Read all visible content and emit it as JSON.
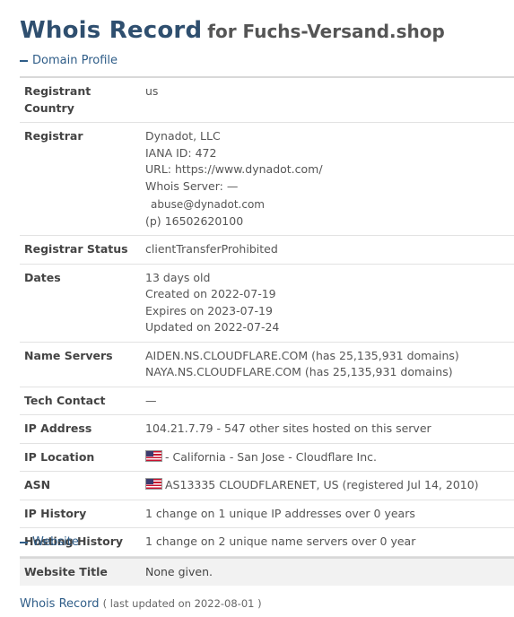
{
  "title": {
    "main": "Whois Record",
    "sub": "for Fuchs-Versand.shop"
  },
  "sections": {
    "domain_profile": "Domain Profile",
    "website": "Website"
  },
  "rows": {
    "registrant_country": {
      "label": "Registrant Country",
      "value": "us"
    },
    "registrar": {
      "label": "Registrar",
      "name": "Dynadot, LLC",
      "iana": "IANA ID: 472",
      "url": "URL: https://www.dynadot.com/",
      "whois_server": "Whois Server: —",
      "email": "abuse@dynadot.com",
      "phone_prefix": "(p)",
      "phone": "16502620100"
    },
    "registrar_status": {
      "label": "Registrar Status",
      "value": "clientTransferProhibited"
    },
    "dates": {
      "label": "Dates",
      "age": "13 days old",
      "created": "Created on 2022-07-19",
      "expires": "Expires on 2023-07-19",
      "updated": "Updated on 2022-07-24"
    },
    "name_servers": {
      "label": "Name Servers",
      "ns1": "AIDEN.NS.CLOUDFLARE.COM (has 25,135,931 domains)",
      "ns2": "NAYA.NS.CLOUDFLARE.COM (has 25,135,931 domains)"
    },
    "tech_contact": {
      "label": "Tech Contact",
      "value": "—"
    },
    "ip_address": {
      "label": "IP Address",
      "value": "104.21.7.79 - 547 other sites hosted on this server"
    },
    "ip_location": {
      "label": "IP Location",
      "value": "- California - San Jose - Cloudflare Inc.",
      "flag": "us-flag-icon"
    },
    "asn": {
      "label": "ASN",
      "value": "AS13335 CLOUDFLARENET, US (registered Jul 14, 2010)",
      "flag": "us-flag-icon"
    },
    "ip_history": {
      "label": "IP History",
      "value": "1 change on 1 unique IP addresses over 0 years"
    },
    "hosting_history": {
      "label": "Hosting History",
      "value": "1 change on 2 unique name servers over 0 year"
    }
  },
  "website": {
    "title_label": "Website Title",
    "title_value": "None given."
  },
  "footer": {
    "link": "Whois Record",
    "updated": "( last updated on 2022-08-01 )"
  }
}
